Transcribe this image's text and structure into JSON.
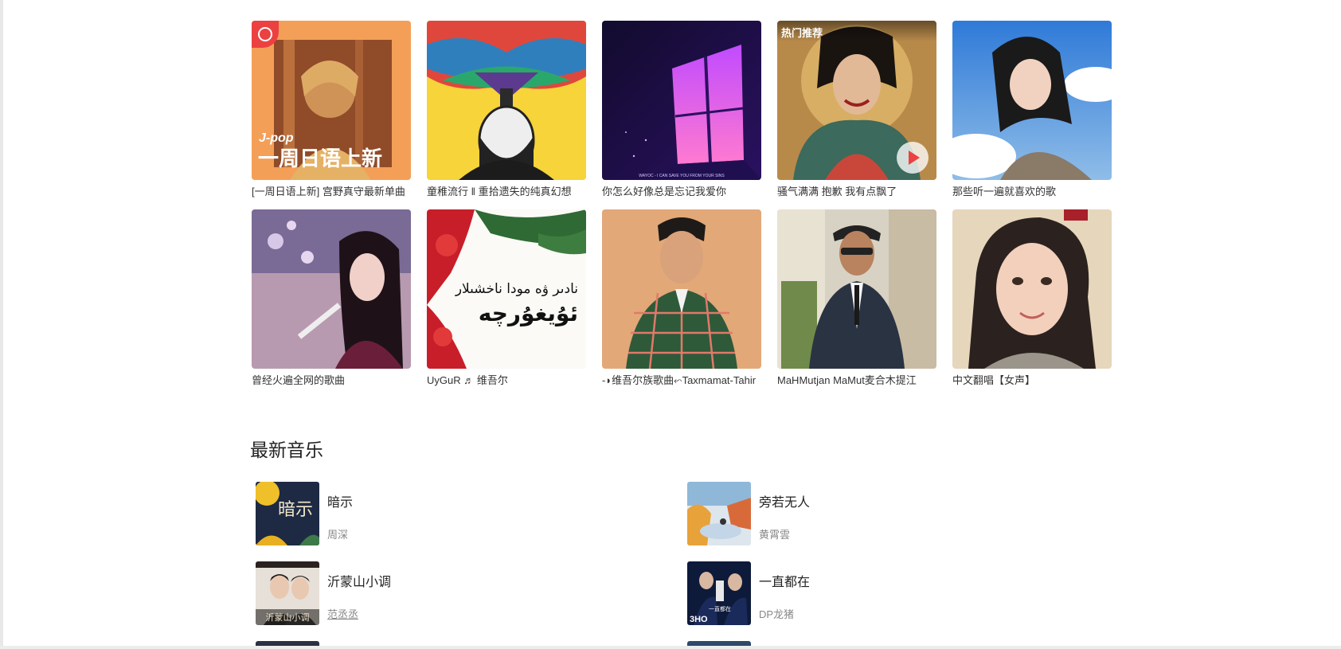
{
  "playlists": [
    {
      "title": "[一周日语上新] 宫野真守最新单曲",
      "cover_text_small": "J-pop",
      "cover_text_big": "一周日语上新"
    },
    {
      "title": "童稚流行 ‖ 重拾遗失的纯真幻想"
    },
    {
      "title": "你怎么好像总是忘记我爱你",
      "cover_caption": "WAYOC - I CAN SAVE YOU FROM YOUR SINS"
    },
    {
      "title": "骚气满满 抱歉 我有点飘了",
      "badge": "热门推荐"
    },
    {
      "title": "那些听一遍就喜欢的歌"
    },
    {
      "title": "曾经火遍全网的歌曲"
    },
    {
      "title": "UyGuR ♬ 维吾尔",
      "cover_text_small": "نادىر ۋە مودا ناخشىلار",
      "cover_text_big": "ئۇيغۇرچە"
    },
    {
      "title": "-◗维吾尔族歌曲⬿Taxmamat-Tahir"
    },
    {
      "title": "MaHMutjan MaMut麦合木提江"
    },
    {
      "title": "中文翻唱【女声】"
    }
  ],
  "newest": {
    "title": "最新音乐",
    "songs": [
      {
        "name": "暗示",
        "artist": "周深",
        "cover_glyph": "暗示"
      },
      {
        "name": "旁若无人",
        "artist": "黄霄雲"
      },
      {
        "name": "沂蒙山小调",
        "artist": "范丞丞",
        "cover_glyph": "沂蒙山小调"
      },
      {
        "name": "一直都在",
        "artist": "DP龙猪",
        "cover_glyph": "一直都在"
      }
    ]
  },
  "colors": {
    "accent": "#ec4141",
    "text": "#333333",
    "muted": "#888888"
  }
}
